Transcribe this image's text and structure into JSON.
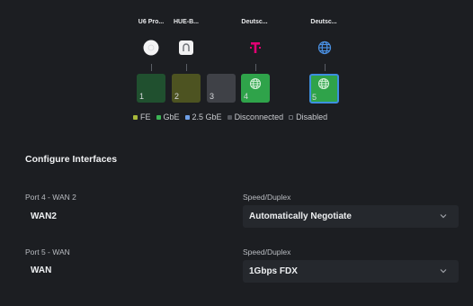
{
  "devices": [
    {
      "label": "U6 Pro...",
      "icon": "access-point-icon"
    },
    {
      "label": "HUE-B...",
      "icon": "hue-bridge-icon"
    },
    {
      "label": "Deutsc...",
      "icon": "telekom-logo-icon"
    },
    {
      "label": "Deutsc...",
      "icon": "globe-icon"
    }
  ],
  "ports": [
    {
      "number": "1",
      "status": "GbE"
    },
    {
      "number": "2",
      "status": "FE"
    },
    {
      "number": "3",
      "status": "Disconnected"
    },
    {
      "number": "4",
      "status": "GbE",
      "wan": true
    },
    {
      "number": "5",
      "status": "GbE",
      "wan": true,
      "selected": true
    }
  ],
  "legend": [
    {
      "label": "FE",
      "color": "#a8b93a"
    },
    {
      "label": "GbE",
      "color": "#3cb455"
    },
    {
      "label": "2.5 GbE",
      "color": "#6fa0e8"
    },
    {
      "label": "Disconnected",
      "color": "#55585e"
    },
    {
      "label": "Disabled",
      "color": "#1c1e22"
    }
  ],
  "colors": {
    "telekom_magenta": "#e20074",
    "globe_blue": "#4a90e2",
    "selected_border": "#3d8fe0"
  },
  "section": {
    "title": "Configure Interfaces"
  },
  "interfaces": [
    {
      "port_label": "Port 4 - WAN 2",
      "name": "WAN2",
      "speed_label": "Speed/Duplex",
      "speed_value": "Automatically Negotiate"
    },
    {
      "port_label": "Port 5 - WAN",
      "name": "WAN",
      "speed_label": "Speed/Duplex",
      "speed_value": "1Gbps FDX"
    }
  ]
}
